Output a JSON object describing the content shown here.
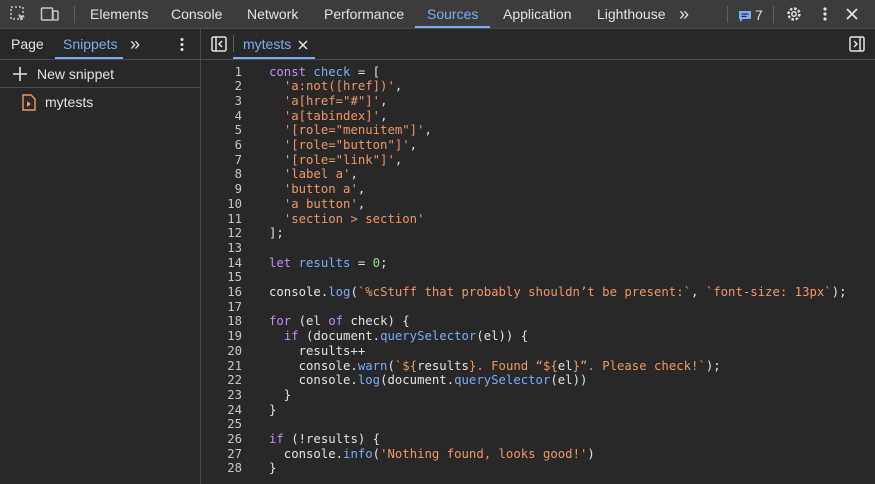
{
  "toolbar": {
    "tabs": [
      "Elements",
      "Console",
      "Network",
      "Performance",
      "Sources",
      "Application",
      "Lighthouse"
    ],
    "active_tab": "Sources",
    "more_tabs_label": "»",
    "issues_count": "7"
  },
  "navigator": {
    "tabs": [
      "Page",
      "Snippets"
    ],
    "active_tab": "Snippets",
    "more_label": "»",
    "new_snippet_label": "New snippet",
    "snippets": [
      "mytests"
    ]
  },
  "editor": {
    "open_file": "mytests",
    "lines": [
      {
        "n": "1",
        "t": [
          [
            "kw",
            "const "
          ],
          [
            "var",
            "check"
          ],
          [
            "p",
            " = ["
          ]
        ]
      },
      {
        "n": "2",
        "t": [
          [
            "p",
            "  "
          ],
          [
            "str",
            "'a:not([href])'"
          ],
          [
            "p",
            ","
          ]
        ]
      },
      {
        "n": "3",
        "t": [
          [
            "p",
            "  "
          ],
          [
            "str",
            "'a[href=\"#\"]'"
          ],
          [
            "p",
            ","
          ]
        ]
      },
      {
        "n": "4",
        "t": [
          [
            "p",
            "  "
          ],
          [
            "str",
            "'a[tabindex]'"
          ],
          [
            "p",
            ","
          ]
        ]
      },
      {
        "n": "5",
        "t": [
          [
            "p",
            "  "
          ],
          [
            "str",
            "'[role=\"menuitem\"]'"
          ],
          [
            "p",
            ","
          ]
        ]
      },
      {
        "n": "6",
        "t": [
          [
            "p",
            "  "
          ],
          [
            "str",
            "'[role=\"button\"]'"
          ],
          [
            "p",
            ","
          ]
        ]
      },
      {
        "n": "7",
        "t": [
          [
            "p",
            "  "
          ],
          [
            "str",
            "'[role=\"link\"]'"
          ],
          [
            "p",
            ","
          ]
        ]
      },
      {
        "n": "8",
        "t": [
          [
            "p",
            "  "
          ],
          [
            "str",
            "'label a'"
          ],
          [
            "p",
            ","
          ]
        ]
      },
      {
        "n": "9",
        "t": [
          [
            "p",
            "  "
          ],
          [
            "str",
            "'button a'"
          ],
          [
            "p",
            ","
          ]
        ]
      },
      {
        "n": "10",
        "t": [
          [
            "p",
            "  "
          ],
          [
            "str",
            "'a button'"
          ],
          [
            "p",
            ","
          ]
        ]
      },
      {
        "n": "11",
        "t": [
          [
            "p",
            "  "
          ],
          [
            "str",
            "'section > section'"
          ]
        ]
      },
      {
        "n": "12",
        "t": [
          [
            "p",
            "];"
          ]
        ]
      },
      {
        "n": "13",
        "t": []
      },
      {
        "n": "14",
        "t": [
          [
            "kw",
            "let "
          ],
          [
            "var",
            "results"
          ],
          [
            "p",
            " = "
          ],
          [
            "num",
            "0"
          ],
          [
            "p",
            ";"
          ]
        ]
      },
      {
        "n": "15",
        "t": []
      },
      {
        "n": "16",
        "t": [
          [
            "p",
            "console."
          ],
          [
            "fn",
            "log"
          ],
          [
            "p",
            "("
          ],
          [
            "str",
            "`%cStuff that probably shouldn’t be present:`"
          ],
          [
            "p",
            ", "
          ],
          [
            "str",
            "`font-size: 13px`"
          ],
          [
            "p",
            ");"
          ]
        ]
      },
      {
        "n": "17",
        "t": []
      },
      {
        "n": "18",
        "t": [
          [
            "kw",
            "for"
          ],
          [
            "p",
            " (el "
          ],
          [
            "kw",
            "of"
          ],
          [
            "p",
            " check) {"
          ]
        ]
      },
      {
        "n": "19",
        "t": [
          [
            "p",
            "  "
          ],
          [
            "kw",
            "if"
          ],
          [
            "p",
            " (document."
          ],
          [
            "fn",
            "querySelector"
          ],
          [
            "p",
            "(el)) {"
          ]
        ]
      },
      {
        "n": "20",
        "t": [
          [
            "p",
            "    results++"
          ]
        ]
      },
      {
        "n": "21",
        "t": [
          [
            "p",
            "    console."
          ],
          [
            "fn",
            "warn"
          ],
          [
            "p",
            "("
          ],
          [
            "str",
            "`${"
          ],
          [
            "p",
            "results"
          ],
          [
            "str",
            "}. Found “${"
          ],
          [
            "p",
            "el"
          ],
          [
            "str",
            "}”. Please check!`"
          ],
          [
            "p",
            ");"
          ]
        ]
      },
      {
        "n": "22",
        "t": [
          [
            "p",
            "    console."
          ],
          [
            "fn",
            "log"
          ],
          [
            "p",
            "(document."
          ],
          [
            "fn",
            "querySelector"
          ],
          [
            "p",
            "(el))"
          ]
        ]
      },
      {
        "n": "23",
        "t": [
          [
            "p",
            "  }"
          ]
        ]
      },
      {
        "n": "24",
        "t": [
          [
            "p",
            "}"
          ]
        ]
      },
      {
        "n": "25",
        "t": []
      },
      {
        "n": "26",
        "t": [
          [
            "kw",
            "if"
          ],
          [
            "p",
            " (!results) {"
          ]
        ]
      },
      {
        "n": "27",
        "t": [
          [
            "p",
            "  console."
          ],
          [
            "fn",
            "info"
          ],
          [
            "p",
            "("
          ],
          [
            "str",
            "'Nothing found, looks good!'"
          ],
          [
            "p",
            ")"
          ]
        ]
      },
      {
        "n": "28",
        "t": [
          [
            "p",
            "}"
          ]
        ]
      }
    ]
  },
  "colors": {
    "accent": "#7cacf8",
    "keyword": "#c58af9",
    "string": "#f29766",
    "number": "#9bdd93",
    "snippet_icon": "#f29766"
  }
}
